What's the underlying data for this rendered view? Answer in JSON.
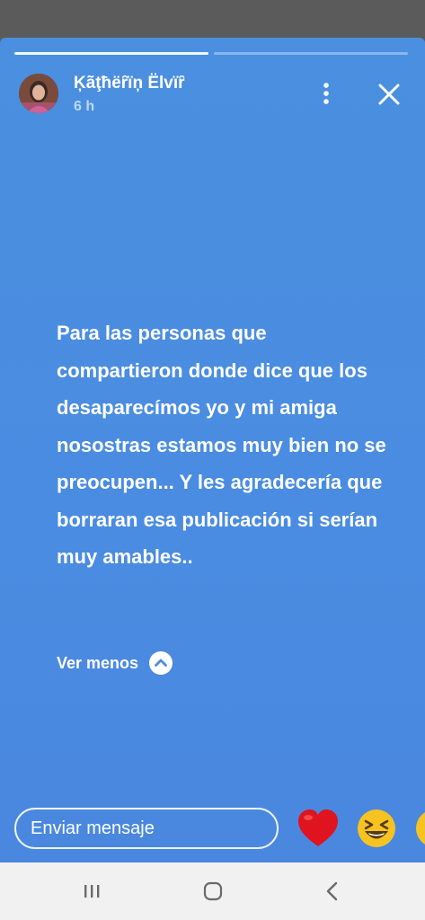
{
  "story": {
    "progress": [
      1,
      0
    ],
    "username": "Ķãţħëȓïņ Ëlvïȓ",
    "time_ago": "6 h",
    "text": "Para las personas que compartieron donde dice que los desaparecímos yo y mi amiga nosostras estamos muy bien no se preocupen... Y les agradecería que borraran esa publicación si serían muy amables..",
    "see_less_label": "Ver menos"
  },
  "composer": {
    "placeholder": "Enviar mensaje"
  },
  "reactions": [
    "heart-emoji",
    "laughing-emoji",
    "smiling-emoji"
  ],
  "nav_bar": [
    "recent-apps-icon",
    "home-icon",
    "back-icon"
  ],
  "colors": {
    "story_background": "#4a8ce1",
    "status_bar": "#5b5b5b",
    "nav_bar": "#f1f1f1"
  }
}
